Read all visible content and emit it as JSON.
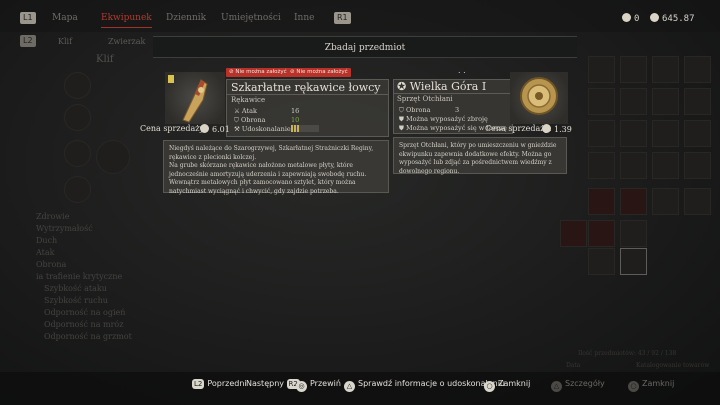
{
  "header": {
    "left_button": "L1",
    "right_button": "R1",
    "tabs": [
      {
        "label": "Mapa",
        "active": false
      },
      {
        "label": "Ekwipunek",
        "active": true
      },
      {
        "label": "Dziennik",
        "active": false
      },
      {
        "label": "Umiejętności",
        "active": false
      },
      {
        "label": "Inne",
        "active": false
      }
    ],
    "sub_left_button": "L2",
    "subtabs": [
      "Klif",
      "Zwierzak"
    ],
    "currency_a": "0",
    "currency_b": "645.87"
  },
  "dialog": {
    "title": "Zbadaj przedmiot",
    "dots": ". ."
  },
  "left_item": {
    "tags": [
      "Nie można założyć",
      "Nie można założyć"
    ],
    "name": "Szkarłatne rękawice łowcy",
    "category": "Rękawice",
    "stats": [
      {
        "label": "Atak",
        "value": "16",
        "highlight": false
      },
      {
        "label": "Obrona",
        "value": "10",
        "highlight": true
      },
      {
        "label": "Udoskonalanie",
        "value": "",
        "highlight": false
      }
    ],
    "upgrade_level": 0.3,
    "price_label": "Cena sprzedaży:",
    "price": "6.01",
    "description": "Niegdyś należące do Szarogrzywej, Szkarłatnej Strażniczki Reginy, rękawice z plecionki kolczej.\nNa grube skórzane rękawice nałożono metalowe płyty, które jednocześnie amortyzują uderzenia i zapewniają swobodę ruchu. Wewnątrz metalowych płyt zamocowano sztylet, który można natychmiast wyciągnąć i chwycić, gdy zajdzie potrzeba."
  },
  "right_item": {
    "name": "Wielka Góra I",
    "category": "Sprzęt Otchłani",
    "stats": [
      {
        "label": "Obrona",
        "value": "3"
      },
      {
        "label": "Można wyposażyć zbroję",
        "value": ""
      },
      {
        "label": "Można wyposażyć się w tarczę",
        "value": ""
      }
    ],
    "price_label": "Cena sprzedaży:",
    "price": "1.39",
    "description": "Sprzęt Otchłani, który po umieszczeniu w gnieździe ekwipunku zapewnia dodatkowe efekty. Można go wyposażyć lub zdjąć za pośrednictwem wiedźmy z dowolnego regionu."
  },
  "side_panel": {
    "title": "Klif",
    "stats": [
      "Zdrowie",
      "Wytrzymałość",
      "Duch",
      "Atak",
      "Obrona",
      "ia trafienie krytyczne",
      "Szybkość ataku",
      "Szybkość ruchu",
      "Odporność na ogień",
      "Odporność na mróz",
      "Odporność na grzmot"
    ]
  },
  "right_panel": {
    "capacity": "Ilość przedmiotów: 43 / 92 / 138",
    "sort_label": "Data",
    "catalog_label": "Katalogowanie towarów",
    "details_label": "Szczegóły",
    "close_label": "Zamknij"
  },
  "footer": {
    "prev_button": "L2",
    "prev_label": "Poprzedni",
    "next_label": "Następny",
    "next_button": "R2",
    "scroll_label": "Przewiń",
    "check_label": "Sprawdź informacje o udoskonalaniu",
    "close_label": "Zamknij"
  },
  "colors": {
    "accent": "#b03a2e",
    "tag": "#b8322a",
    "positive": "#7fa84a"
  }
}
